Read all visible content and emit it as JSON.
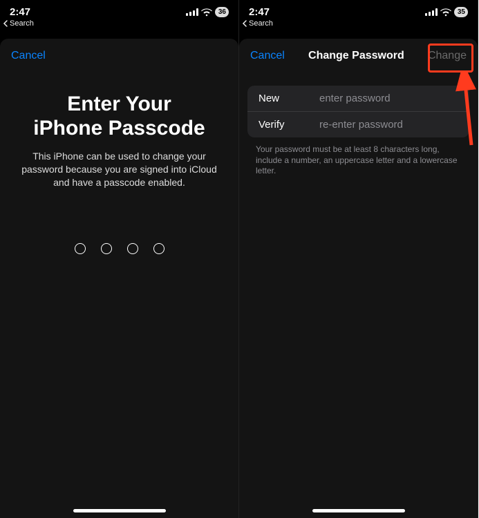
{
  "left": {
    "status": {
      "time": "2:47",
      "battery": "36"
    },
    "back_search": "Search",
    "cancel": "Cancel",
    "title_line1": "Enter Your",
    "title_line2": "iPhone Passcode",
    "body": "This iPhone can be used to change your password because you are signed into iCloud and have a passcode enabled."
  },
  "right": {
    "status": {
      "time": "2:47",
      "battery": "35"
    },
    "back_search": "Search",
    "cancel": "Cancel",
    "nav_title": "Change Password",
    "change": "Change",
    "rows": {
      "new_label": "New",
      "new_placeholder": "enter password",
      "verify_label": "Verify",
      "verify_placeholder": "re-enter password"
    },
    "helper": "Your password must be at least 8 characters long, include a number, an uppercase letter and a lowercase letter."
  },
  "annotation": {
    "highlight_color": "#ff3b1e"
  }
}
